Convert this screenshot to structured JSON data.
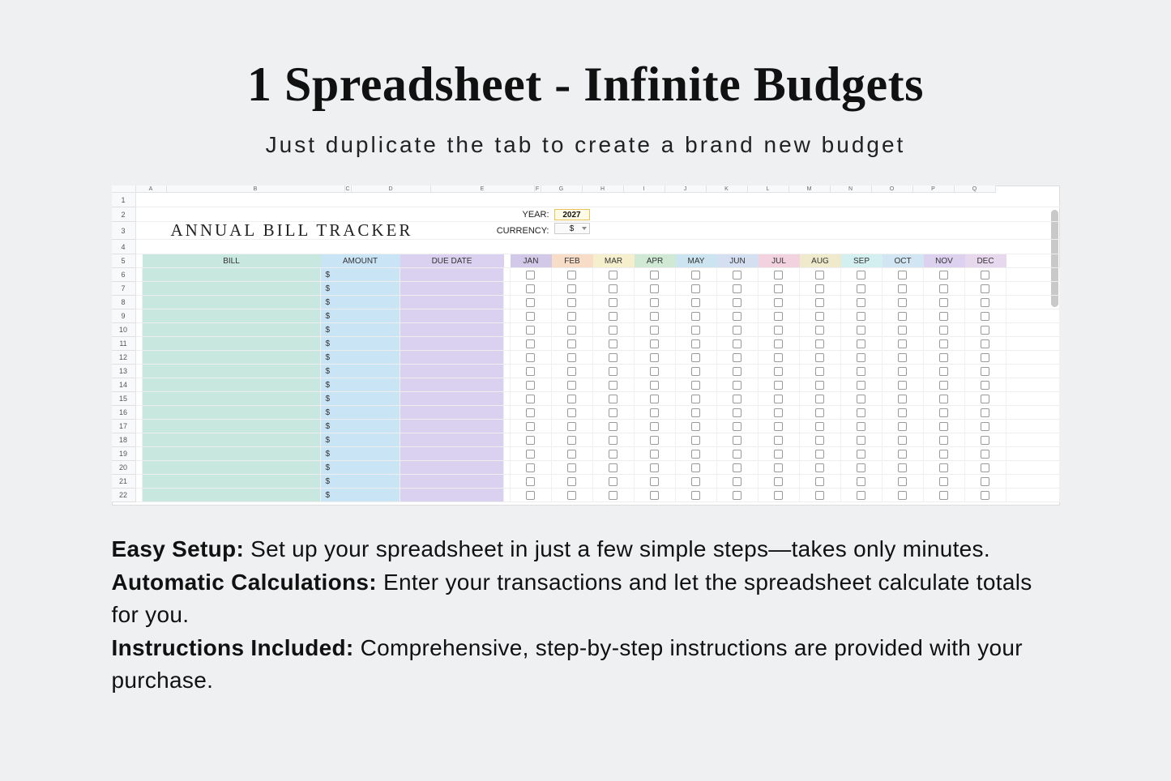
{
  "hero": {
    "title": "1 Spreadsheet - Infinite Budgets",
    "subtitle": "Just duplicate the tab to create a brand new budget"
  },
  "sheet": {
    "title": "ANNUAL  BILL  TRACKER",
    "year_label": "YEAR:",
    "year_value": "2027",
    "currency_label": "CURRENCY:",
    "currency_value": "$",
    "column_letters": [
      "",
      "A",
      "B",
      "C",
      "D",
      "E",
      "F",
      "G",
      "H",
      "I",
      "J",
      "K",
      "L",
      "M",
      "N",
      "O",
      "P",
      "Q"
    ],
    "row_numbers": [
      "1",
      "2",
      "3",
      "4",
      "5",
      "6",
      "7",
      "8",
      "9",
      "10",
      "11",
      "12",
      "13",
      "14",
      "15",
      "16",
      "17",
      "18",
      "19",
      "20",
      "21",
      "22"
    ],
    "headers": {
      "bill": "BILL",
      "amount": "AMOUNT",
      "due": "DUE DATE"
    },
    "months": [
      "JAN",
      "FEB",
      "MAR",
      "APR",
      "MAY",
      "JUN",
      "JUL",
      "AUG",
      "SEP",
      "OCT",
      "NOV",
      "DEC"
    ],
    "amount_prefix": "$",
    "data_row_count": 17
  },
  "features": [
    {
      "label": "Easy Setup:",
      "text": " Set up your spreadsheet in just a few simple steps—takes only minutes."
    },
    {
      "label": "Automatic Calculations:",
      "text": " Enter your transactions and let the spreadsheet calculate totals for you."
    },
    {
      "label": "Instructions Included:",
      "text": " Comprehensive, step-by-step instructions are provided with your purchase."
    }
  ]
}
